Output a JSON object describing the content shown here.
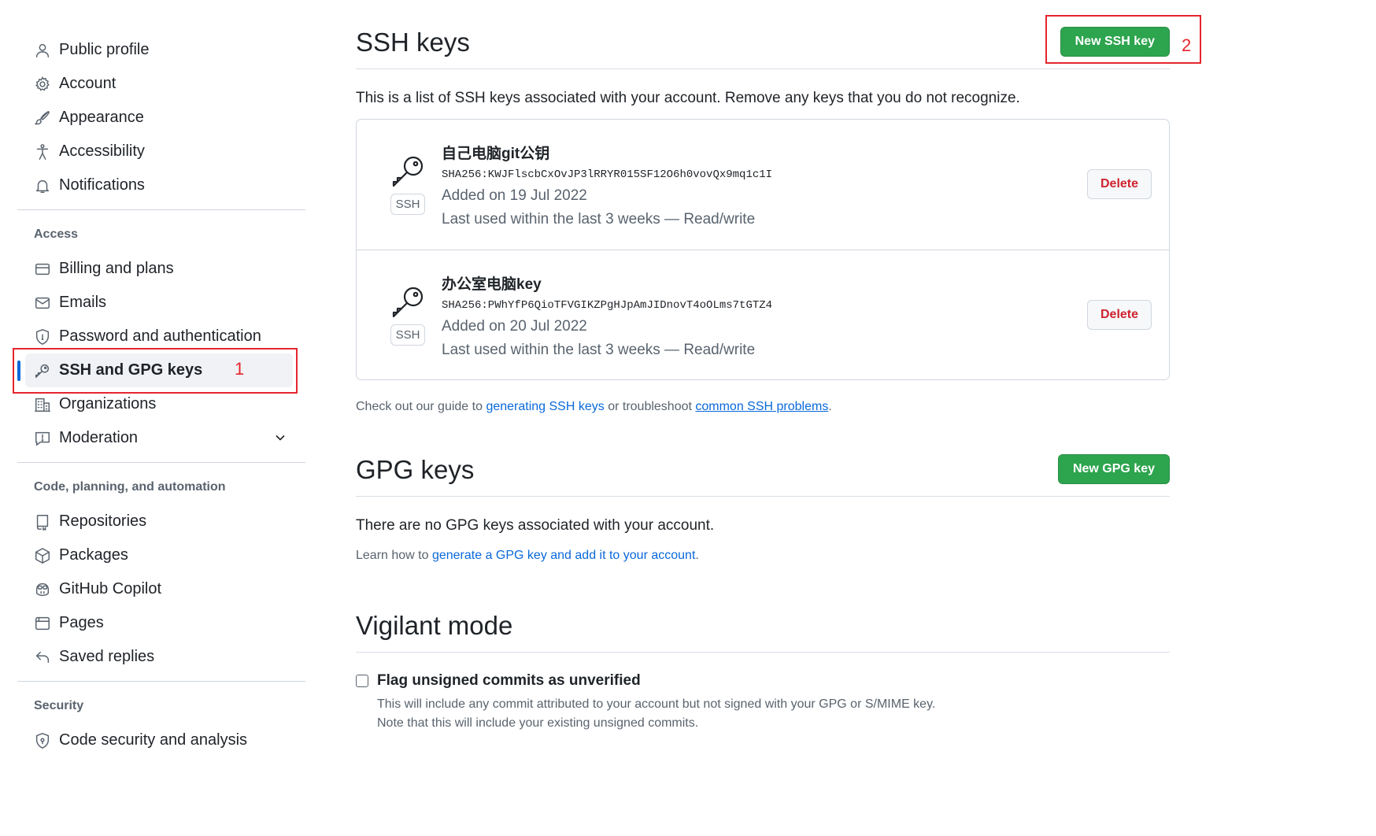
{
  "sidebar": {
    "items_top": [
      {
        "label": "Public profile",
        "icon": "person-icon"
      },
      {
        "label": "Account",
        "icon": "gear-icon"
      },
      {
        "label": "Appearance",
        "icon": "paintbrush-icon"
      },
      {
        "label": "Accessibility",
        "icon": "accessibility-icon"
      },
      {
        "label": "Notifications",
        "icon": "bell-icon"
      }
    ],
    "access_title": "Access",
    "access_items": [
      {
        "label": "Billing and plans",
        "icon": "credit-card-icon"
      },
      {
        "label": "Emails",
        "icon": "mail-icon"
      },
      {
        "label": "Password and authentication",
        "icon": "shield-lock-icon"
      },
      {
        "label": "SSH and GPG keys",
        "icon": "key-icon"
      },
      {
        "label": "Organizations",
        "icon": "organization-icon"
      },
      {
        "label": "Moderation",
        "icon": "report-icon"
      }
    ],
    "code_title": "Code, planning, and automation",
    "code_items": [
      {
        "label": "Repositories",
        "icon": "repo-icon"
      },
      {
        "label": "Packages",
        "icon": "package-icon"
      },
      {
        "label": "GitHub Copilot",
        "icon": "copilot-icon"
      },
      {
        "label": "Pages",
        "icon": "browser-icon"
      },
      {
        "label": "Saved replies",
        "icon": "reply-icon"
      }
    ],
    "security_title": "Security",
    "security_items": [
      {
        "label": "Code security and analysis",
        "icon": "shield-lock-icon"
      }
    ]
  },
  "annotations": {
    "first": "1",
    "second": "2",
    "color": "#e5262e"
  },
  "ssh": {
    "title": "SSH keys",
    "new_button": "New SSH key",
    "description": "This is a list of SSH keys associated with your account. Remove any keys that you do not recognize.",
    "keys": [
      {
        "title": "自己电脑git公钥",
        "fingerprint": "SHA256:KWJFlscbCxOvJP3lRRYR015SF12O6h0vovQx9mq1c1I",
        "added": "Added on 19 Jul 2022",
        "last_used": "Last used within the last 3 weeks — Read/write",
        "badge": "SSH",
        "delete": "Delete"
      },
      {
        "title": "办公室电脑key",
        "fingerprint": "SHA256:PWhYfP6QioTFVGIKZPgHJpAmJIDnovT4oOLms7tGTZ4",
        "added": "Added on 20 Jul 2022",
        "last_used": "Last used within the last 3 weeks — Read/write",
        "badge": "SSH",
        "delete": "Delete"
      }
    ],
    "guide_prefix": "Check out our guide to ",
    "guide_link": "generating SSH keys",
    "guide_mid": " or troubleshoot ",
    "problems_link": "common SSH problems",
    "guide_suffix": "."
  },
  "gpg": {
    "title": "GPG keys",
    "new_button": "New GPG key",
    "empty": "There are no GPG keys associated with your account.",
    "learn_prefix": "Learn how to ",
    "learn_link": "generate a GPG key and add it to your account",
    "learn_suffix": "."
  },
  "vigilant": {
    "title": "Vigilant mode",
    "checkbox_label": "Flag unsigned commits as unverified",
    "checked": false,
    "note_line1": "This will include any commit attributed to your account but not signed with your GPG or S/MIME key.",
    "note_line2": "Note that this will include your existing unsigned commits."
  },
  "colors": {
    "accent": "#0969da",
    "green": "#2da44e",
    "danger": "#cf222e"
  }
}
